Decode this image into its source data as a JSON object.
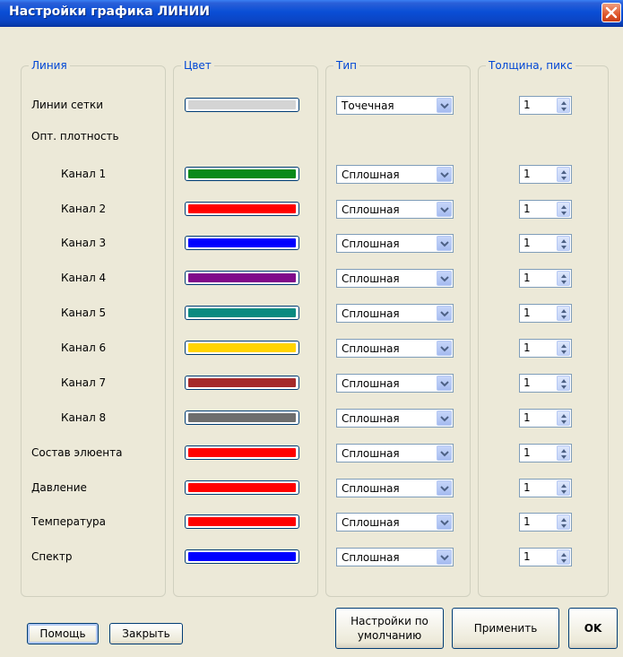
{
  "window": {
    "title": "Настройки графика ЛИНИИ"
  },
  "columns": {
    "line": "Линия",
    "color": "Цвет",
    "type": "Тип",
    "thickness": "Толщина, пикс"
  },
  "rows": [
    {
      "label": "Линии сетки",
      "color": "#d4d4d4",
      "type": "Точечная",
      "thickness": "1"
    },
    {
      "label": "Опт. плотность"
    },
    {
      "label": "Канал 1",
      "color": "#0a8a1a",
      "type": "Сплошная",
      "thickness": "1"
    },
    {
      "label": "Канал 2",
      "color": "#ff0000",
      "type": "Сплошная",
      "thickness": "1"
    },
    {
      "label": "Канал 3",
      "color": "#0000ff",
      "type": "Сплошная",
      "thickness": "1"
    },
    {
      "label": "Канал 4",
      "color": "#800a8a",
      "type": "Сплошная",
      "thickness": "1"
    },
    {
      "label": "Канал 5",
      "color": "#0a8a80",
      "type": "Сплошная",
      "thickness": "1"
    },
    {
      "label": "Канал 6",
      "color": "#ffd400",
      "type": "Сплошная",
      "thickness": "1"
    },
    {
      "label": "Канал 7",
      "color": "#a52a2a",
      "type": "Сплошная",
      "thickness": "1"
    },
    {
      "label": "Канал 8",
      "color": "#6e6e6e",
      "type": "Сплошная",
      "thickness": "1"
    },
    {
      "label": "Состав элюента",
      "color": "#ff0000",
      "type": "Сплошная",
      "thickness": "1"
    },
    {
      "label": "Давление",
      "color": "#ff0000",
      "type": "Сплошная",
      "thickness": "1"
    },
    {
      "label": "Температура",
      "color": "#ff0000",
      "type": "Сплошная",
      "thickness": "1"
    },
    {
      "label": "Спектр",
      "color": "#0000ff",
      "type": "Сплошная",
      "thickness": "1"
    }
  ],
  "buttons": {
    "help": "Помощь",
    "close": "Закрыть",
    "defaults_line1": "Настройки по",
    "defaults_line2": "умолчанию",
    "apply": "Применить",
    "ok": "OK"
  },
  "icons": {
    "close": "close-icon",
    "dropdown": "chevron-down-icon",
    "spinner": "up-down-arrows-icon"
  }
}
